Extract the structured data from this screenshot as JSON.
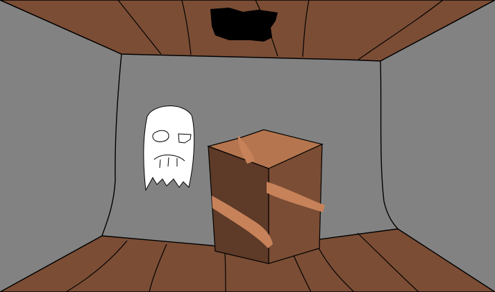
{
  "scene": {
    "colors": {
      "walls": "#828282",
      "wood": "#7b4d35",
      "wood_dark": "#5e3a28",
      "crate_top": "#b5754f",
      "crate_stripe": "#c7825a",
      "ghost": "#ffffff",
      "hole": "#000000",
      "outline": "#000000"
    },
    "objects": [
      "ceiling-hole",
      "ghost",
      "crate"
    ]
  }
}
